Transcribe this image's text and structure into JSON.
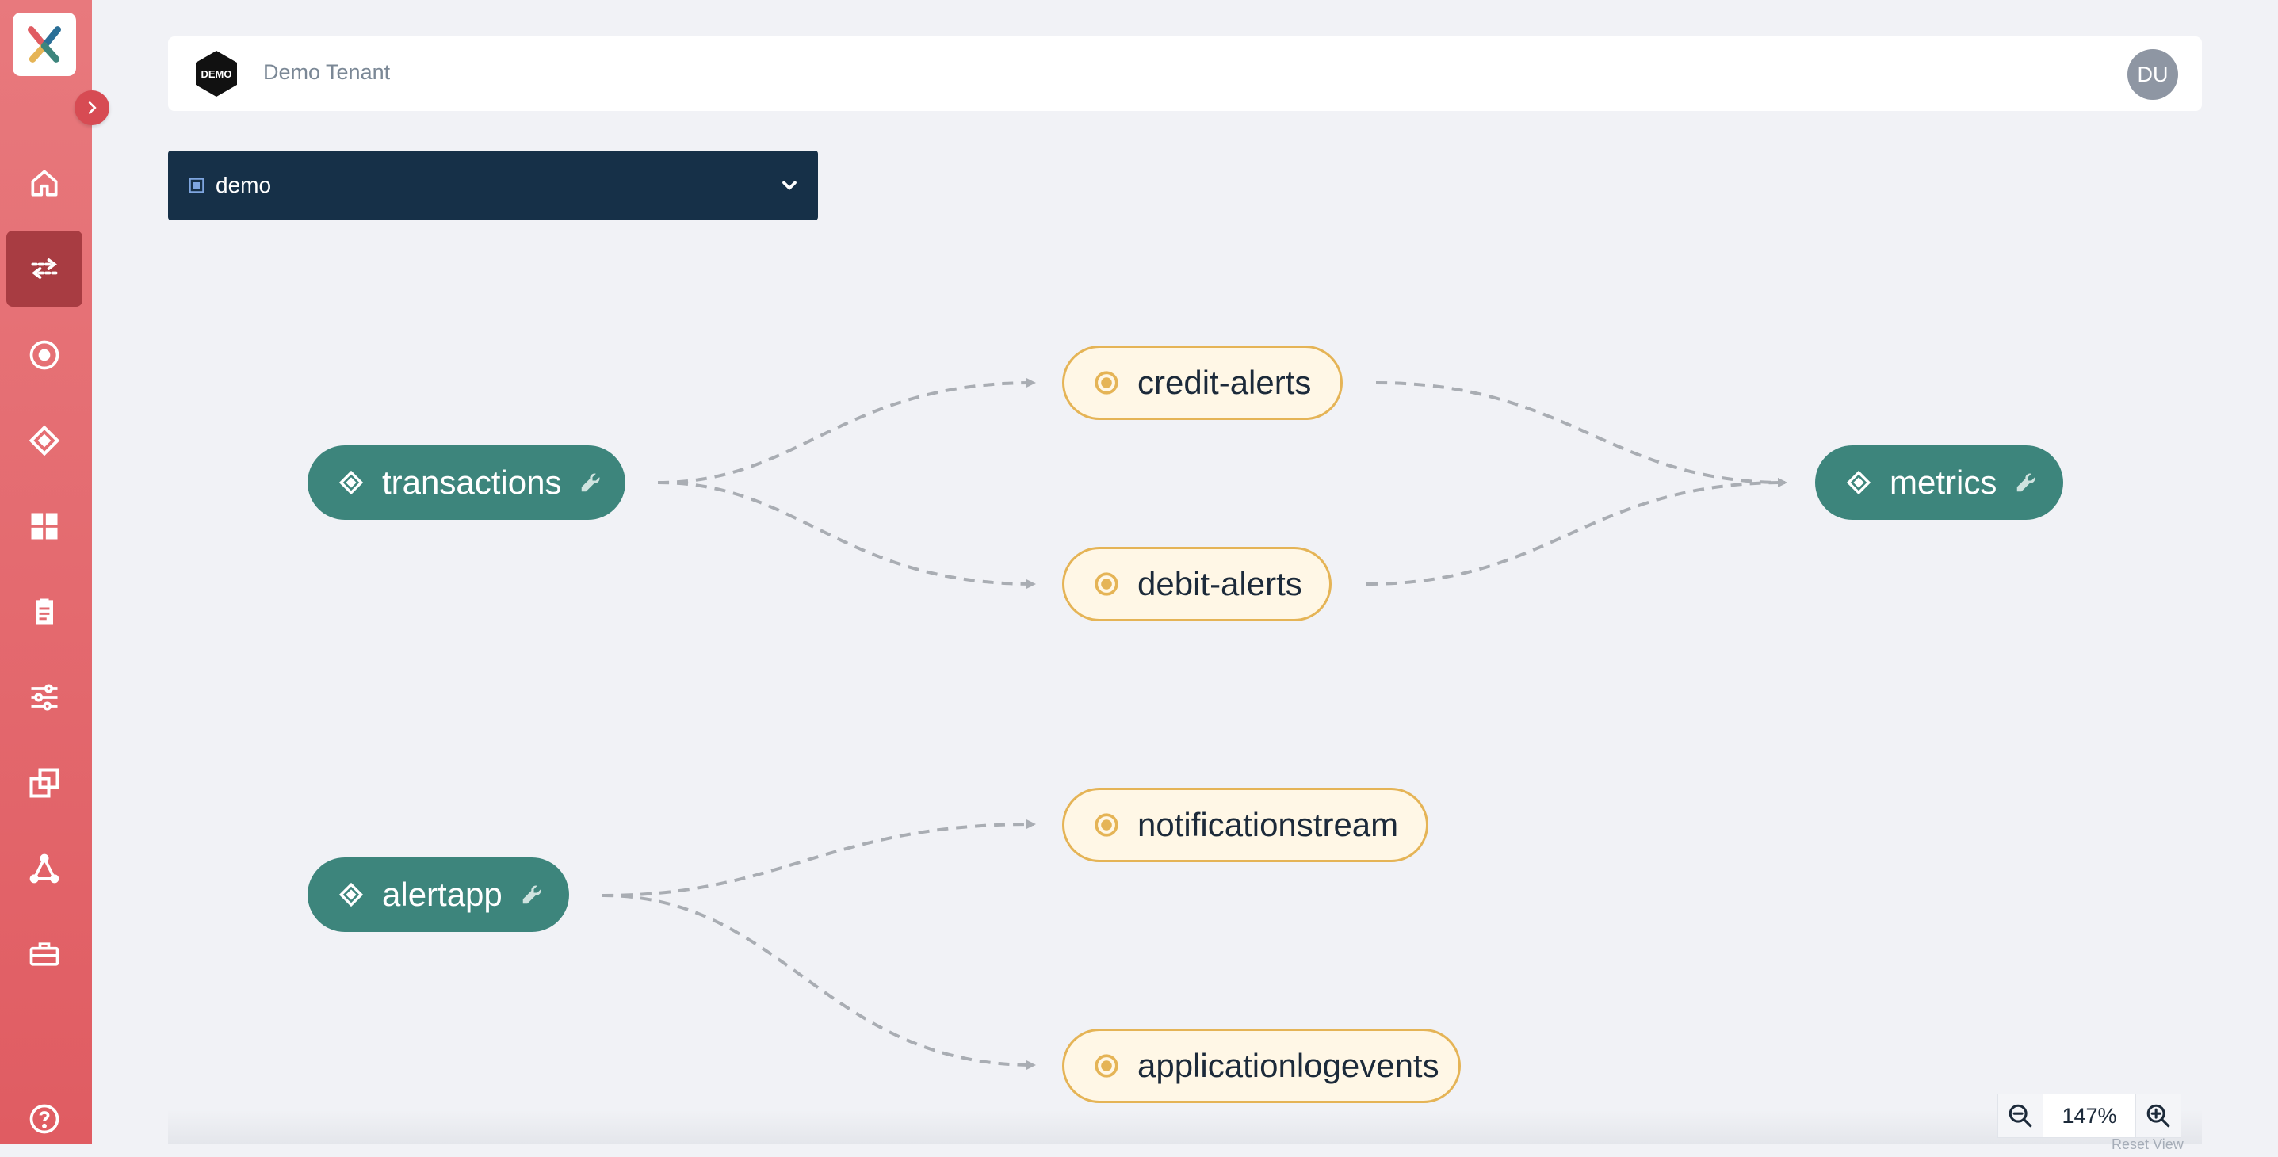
{
  "header": {
    "tenant_logo_text": "DEMO",
    "tenant_name": "Demo Tenant",
    "user_initials": "DU"
  },
  "environment": {
    "selected": "demo"
  },
  "sidebar": {
    "items": [
      {
        "name": "home",
        "icon": "home-icon",
        "active": false
      },
      {
        "name": "data-flow",
        "icon": "arrows-exchange-icon",
        "active": true
      },
      {
        "name": "topics",
        "icon": "target-icon",
        "active": false
      },
      {
        "name": "applications",
        "icon": "diamond-icon",
        "active": false
      },
      {
        "name": "dashboard",
        "icon": "grid-icon",
        "active": false
      },
      {
        "name": "clipboard",
        "icon": "clipboard-icon",
        "active": false
      },
      {
        "name": "settings",
        "icon": "sliders-icon",
        "active": false
      },
      {
        "name": "copy",
        "icon": "copy-icon",
        "active": false
      },
      {
        "name": "network",
        "icon": "network-icon",
        "active": false
      },
      {
        "name": "toolbox",
        "icon": "toolbox-icon",
        "active": false
      },
      {
        "name": "help",
        "icon": "help-icon",
        "active": false
      }
    ]
  },
  "graph": {
    "nodes": {
      "transactions": {
        "label": "transactions",
        "kind": "application"
      },
      "credit_alerts": {
        "label": "credit-alerts",
        "kind": "topic"
      },
      "debit_alerts": {
        "label": "debit-alerts",
        "kind": "topic"
      },
      "metrics": {
        "label": "metrics",
        "kind": "application"
      },
      "alertapp": {
        "label": "alertapp",
        "kind": "application"
      },
      "notificationstream": {
        "label": "notificationstream",
        "kind": "topic"
      },
      "applicationlogevents": {
        "label": "applicationlogevents",
        "kind": "topic"
      }
    },
    "edges": [
      [
        "transactions",
        "credit-alerts"
      ],
      [
        "transactions",
        "debit-alerts"
      ],
      [
        "credit-alerts",
        "metrics"
      ],
      [
        "debit-alerts",
        "metrics"
      ],
      [
        "alertapp",
        "notificationstream"
      ],
      [
        "alertapp",
        "applicationlogevents"
      ]
    ]
  },
  "zoom": {
    "level": "147%",
    "reset_label": "Reset View"
  },
  "colors": {
    "sidebar": "#e05c62",
    "sidebar_active": "#a83c42",
    "app_node": "#3d857c",
    "topic_fill": "#fff7e6",
    "topic_border": "#e5b456",
    "edge": "#a9adb3",
    "env_bar": "#163048"
  }
}
